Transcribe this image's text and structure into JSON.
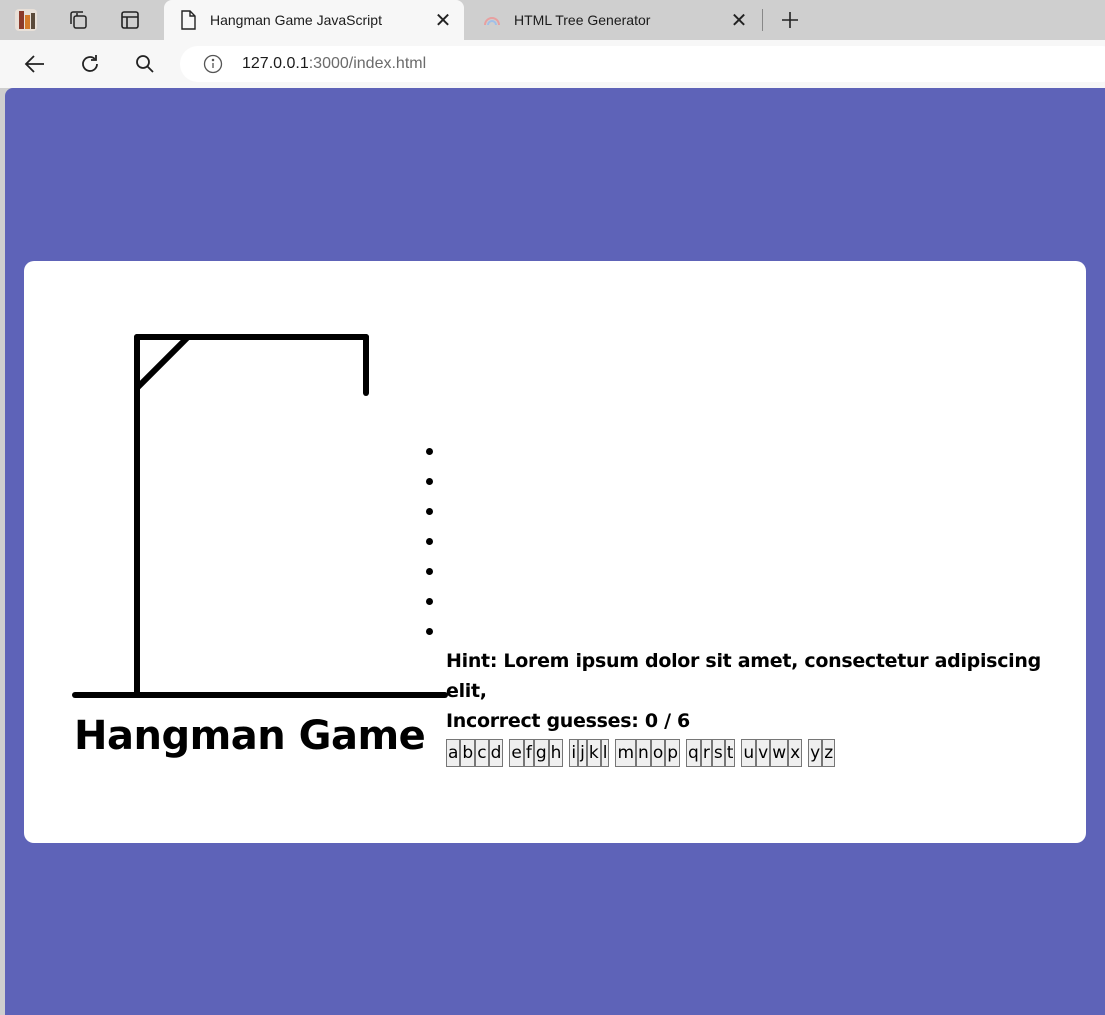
{
  "browser": {
    "tabs": [
      {
        "title": "Hangman Game JavaScript",
        "active": true,
        "icon": "page-icon"
      },
      {
        "title": "HTML Tree Generator",
        "active": false,
        "icon": "rainbow-icon"
      }
    ],
    "address": {
      "host": "127.0.0.1",
      "rest": ":3000/index.html"
    }
  },
  "game": {
    "title": "Hangman Game",
    "hint": "Hint: Lorem ipsum dolor sit amet, consectetur adipiscing elit,",
    "incorrect_guesses": "Incorrect guesses: 0 / 6",
    "word_length": 7,
    "keyboard_groups": [
      [
        "a",
        "b",
        "c",
        "d"
      ],
      [
        "e",
        "f",
        "g",
        "h"
      ],
      [
        "i",
        "j",
        "k",
        "l"
      ],
      [
        "m",
        "n",
        "o",
        "p"
      ],
      [
        "q",
        "r",
        "s",
        "t"
      ],
      [
        "u",
        "v",
        "w",
        "x"
      ],
      [
        "y",
        "z"
      ]
    ]
  },
  "colors": {
    "page_bg": "#5e63b8",
    "card_bg": "#ffffff"
  }
}
